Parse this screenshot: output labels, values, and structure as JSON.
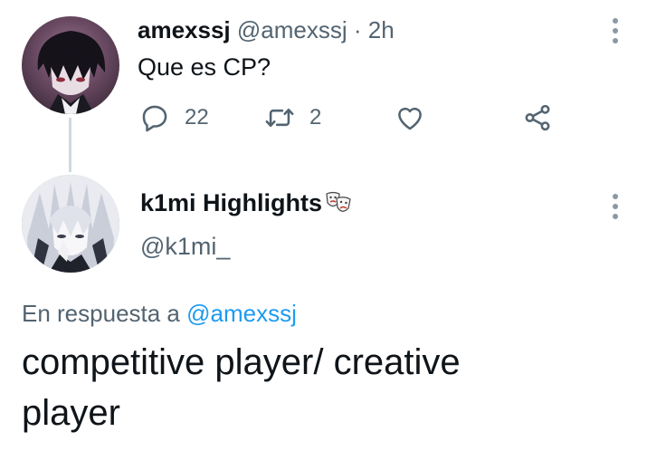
{
  "parent_tweet": {
    "display_name": "amexssj",
    "handle": "@amexssj",
    "separator": "·",
    "time": "2h",
    "text": "Que es CP?",
    "reply_count": "22",
    "retweet_count": "2"
  },
  "reply_tweet": {
    "display_name": "k1mi Highlights",
    "handle": "@k1mi_",
    "replying_prefix": "En respuesta a",
    "replying_to": "@amexssj",
    "text": "competitive player/ creative player"
  },
  "icons": {
    "reply": "reply-icon",
    "retweet": "retweet-icon",
    "like": "heart-icon",
    "share": "share-icon",
    "more": "more-vertical-icon",
    "emoji": "performing-arts-mask-icon"
  },
  "colors": {
    "text": "#0f1419",
    "secondary": "#536471",
    "link": "#1d9bf0",
    "thread_line": "#cfd9de"
  }
}
